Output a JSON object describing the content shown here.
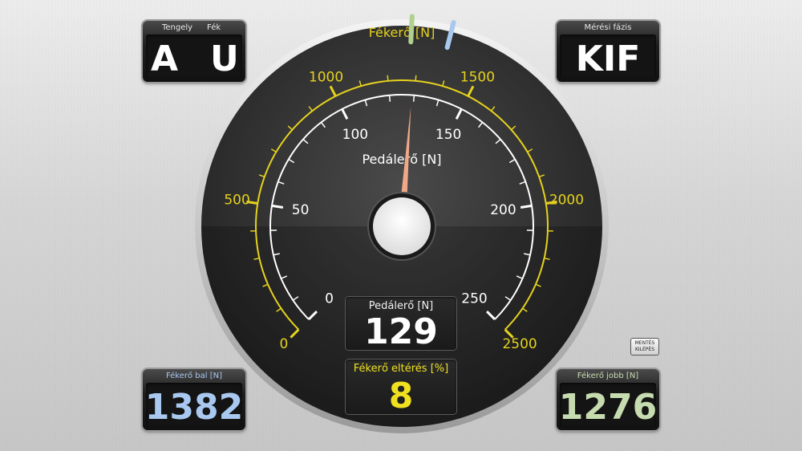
{
  "axle_panel": {
    "axle_label": "Tengely",
    "brake_label": "Fék",
    "axle_value": "A",
    "brake_value": "U"
  },
  "phase_panel": {
    "label": "Mérési fázis",
    "value": "KIF"
  },
  "left_panel": {
    "label": "Fékerő bal [N]",
    "value": "1382",
    "color": "#a8c8f0"
  },
  "right_panel": {
    "label": "Fékerő jobb [N]",
    "value": "1276",
    "color": "#c6dcb0"
  },
  "save_exit_button": {
    "line1": "MENTÉS",
    "line2": "KILÉPÉS"
  },
  "gauge": {
    "outer_title": "Fékerő [N]",
    "inner_title": "Pedálerő [N]",
    "outer_ticks": [
      "0",
      "500",
      "1000",
      "1500",
      "2000",
      "2500"
    ],
    "inner_ticks": [
      "0",
      "50",
      "100",
      "150",
      "200",
      "250"
    ],
    "outer_max": 2500,
    "inner_max": 250,
    "pedal_value": 129,
    "left_brake_value": 1382,
    "right_brake_value": 1276,
    "colors": {
      "outer_scale": "#e6d21e",
      "inner_scale": "#ffffff",
      "pedal_needle": "#f0a888",
      "left_needle": "#a8c8f0",
      "right_needle": "#b0d090"
    }
  },
  "pedal_box": {
    "label": "Pedálerő [N]",
    "value": "129"
  },
  "deviation_box": {
    "label": "Fékerő eltérés [%]",
    "value": "8",
    "color": "#f0e020"
  }
}
